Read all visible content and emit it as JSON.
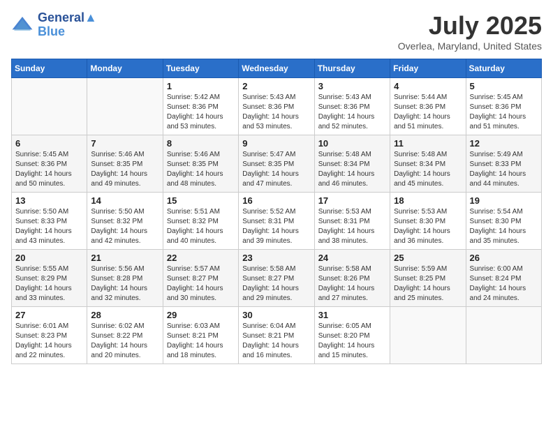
{
  "header": {
    "logo_line1": "General",
    "logo_line2": "Blue",
    "month_title": "July 2025",
    "location": "Overlea, Maryland, United States"
  },
  "weekdays": [
    "Sunday",
    "Monday",
    "Tuesday",
    "Wednesday",
    "Thursday",
    "Friday",
    "Saturday"
  ],
  "weeks": [
    [
      {
        "day": "",
        "info": ""
      },
      {
        "day": "",
        "info": ""
      },
      {
        "day": "1",
        "info": "Sunrise: 5:42 AM\nSunset: 8:36 PM\nDaylight: 14 hours and 53 minutes."
      },
      {
        "day": "2",
        "info": "Sunrise: 5:43 AM\nSunset: 8:36 PM\nDaylight: 14 hours and 53 minutes."
      },
      {
        "day": "3",
        "info": "Sunrise: 5:43 AM\nSunset: 8:36 PM\nDaylight: 14 hours and 52 minutes."
      },
      {
        "day": "4",
        "info": "Sunrise: 5:44 AM\nSunset: 8:36 PM\nDaylight: 14 hours and 51 minutes."
      },
      {
        "day": "5",
        "info": "Sunrise: 5:45 AM\nSunset: 8:36 PM\nDaylight: 14 hours and 51 minutes."
      }
    ],
    [
      {
        "day": "6",
        "info": "Sunrise: 5:45 AM\nSunset: 8:36 PM\nDaylight: 14 hours and 50 minutes."
      },
      {
        "day": "7",
        "info": "Sunrise: 5:46 AM\nSunset: 8:35 PM\nDaylight: 14 hours and 49 minutes."
      },
      {
        "day": "8",
        "info": "Sunrise: 5:46 AM\nSunset: 8:35 PM\nDaylight: 14 hours and 48 minutes."
      },
      {
        "day": "9",
        "info": "Sunrise: 5:47 AM\nSunset: 8:35 PM\nDaylight: 14 hours and 47 minutes."
      },
      {
        "day": "10",
        "info": "Sunrise: 5:48 AM\nSunset: 8:34 PM\nDaylight: 14 hours and 46 minutes."
      },
      {
        "day": "11",
        "info": "Sunrise: 5:48 AM\nSunset: 8:34 PM\nDaylight: 14 hours and 45 minutes."
      },
      {
        "day": "12",
        "info": "Sunrise: 5:49 AM\nSunset: 8:33 PM\nDaylight: 14 hours and 44 minutes."
      }
    ],
    [
      {
        "day": "13",
        "info": "Sunrise: 5:50 AM\nSunset: 8:33 PM\nDaylight: 14 hours and 43 minutes."
      },
      {
        "day": "14",
        "info": "Sunrise: 5:50 AM\nSunset: 8:32 PM\nDaylight: 14 hours and 42 minutes."
      },
      {
        "day": "15",
        "info": "Sunrise: 5:51 AM\nSunset: 8:32 PM\nDaylight: 14 hours and 40 minutes."
      },
      {
        "day": "16",
        "info": "Sunrise: 5:52 AM\nSunset: 8:31 PM\nDaylight: 14 hours and 39 minutes."
      },
      {
        "day": "17",
        "info": "Sunrise: 5:53 AM\nSunset: 8:31 PM\nDaylight: 14 hours and 38 minutes."
      },
      {
        "day": "18",
        "info": "Sunrise: 5:53 AM\nSunset: 8:30 PM\nDaylight: 14 hours and 36 minutes."
      },
      {
        "day": "19",
        "info": "Sunrise: 5:54 AM\nSunset: 8:30 PM\nDaylight: 14 hours and 35 minutes."
      }
    ],
    [
      {
        "day": "20",
        "info": "Sunrise: 5:55 AM\nSunset: 8:29 PM\nDaylight: 14 hours and 33 minutes."
      },
      {
        "day": "21",
        "info": "Sunrise: 5:56 AM\nSunset: 8:28 PM\nDaylight: 14 hours and 32 minutes."
      },
      {
        "day": "22",
        "info": "Sunrise: 5:57 AM\nSunset: 8:27 PM\nDaylight: 14 hours and 30 minutes."
      },
      {
        "day": "23",
        "info": "Sunrise: 5:58 AM\nSunset: 8:27 PM\nDaylight: 14 hours and 29 minutes."
      },
      {
        "day": "24",
        "info": "Sunrise: 5:58 AM\nSunset: 8:26 PM\nDaylight: 14 hours and 27 minutes."
      },
      {
        "day": "25",
        "info": "Sunrise: 5:59 AM\nSunset: 8:25 PM\nDaylight: 14 hours and 25 minutes."
      },
      {
        "day": "26",
        "info": "Sunrise: 6:00 AM\nSunset: 8:24 PM\nDaylight: 14 hours and 24 minutes."
      }
    ],
    [
      {
        "day": "27",
        "info": "Sunrise: 6:01 AM\nSunset: 8:23 PM\nDaylight: 14 hours and 22 minutes."
      },
      {
        "day": "28",
        "info": "Sunrise: 6:02 AM\nSunset: 8:22 PM\nDaylight: 14 hours and 20 minutes."
      },
      {
        "day": "29",
        "info": "Sunrise: 6:03 AM\nSunset: 8:21 PM\nDaylight: 14 hours and 18 minutes."
      },
      {
        "day": "30",
        "info": "Sunrise: 6:04 AM\nSunset: 8:21 PM\nDaylight: 14 hours and 16 minutes."
      },
      {
        "day": "31",
        "info": "Sunrise: 6:05 AM\nSunset: 8:20 PM\nDaylight: 14 hours and 15 minutes."
      },
      {
        "day": "",
        "info": ""
      },
      {
        "day": "",
        "info": ""
      }
    ]
  ]
}
